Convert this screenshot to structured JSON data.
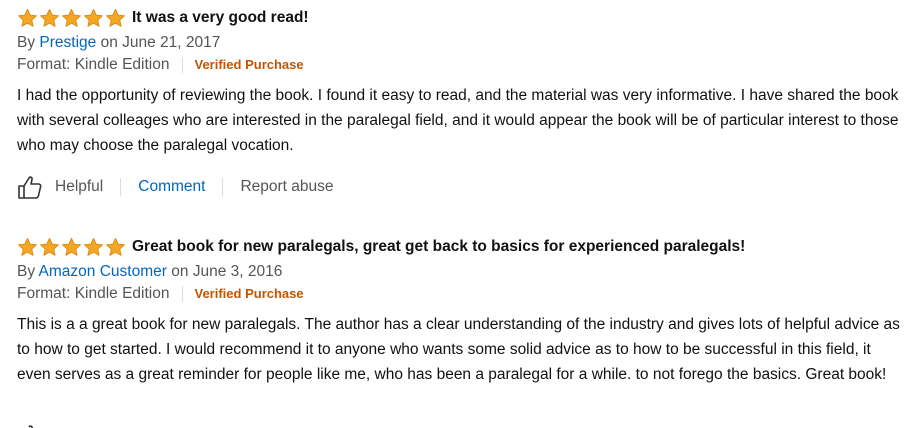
{
  "reviews": [
    {
      "rating": 5,
      "title": "It was a very good read!",
      "by_label": "By",
      "author": "Prestige",
      "date": "on June 21, 2017",
      "format": "Format: Kindle Edition",
      "verified": "Verified Purchase",
      "body": "I had the opportunity of reviewing the book. I found it easy to read, and the material was very informative. I have shared the book with several colleages who are interested in the paralegal field, and it would appear the book will be of particular interest to those who may choose the paralegal vocation."
    },
    {
      "rating": 5,
      "title": "Great book for new paralegals, great get back to basics for experienced paralegals!",
      "by_label": "By",
      "author": "Amazon Customer",
      "date": "on June 3, 2016",
      "format": "Format: Kindle Edition",
      "verified": "Verified Purchase",
      "body": "This is a a great book for new paralegals. The author has a clear understanding of the industry and gives lots of helpful advice as to how to get started. I would recommend it to anyone who wants some solid advice as to how to be successful in this field, it even serves as a great reminder for people like me, who has been a paralegal for a while. to not forego the basics. Great book!"
    }
  ],
  "actions": {
    "helpful": "Helpful",
    "comment": "Comment",
    "report": "Report abuse"
  },
  "icons": {
    "star": "star-icon",
    "thumb": "thumbs-up-icon"
  },
  "colors": {
    "star_fill": "#f5a623",
    "star_stroke": "#d38b0e",
    "link": "#0066c0",
    "verified": "#c45500",
    "muted": "#555555"
  }
}
